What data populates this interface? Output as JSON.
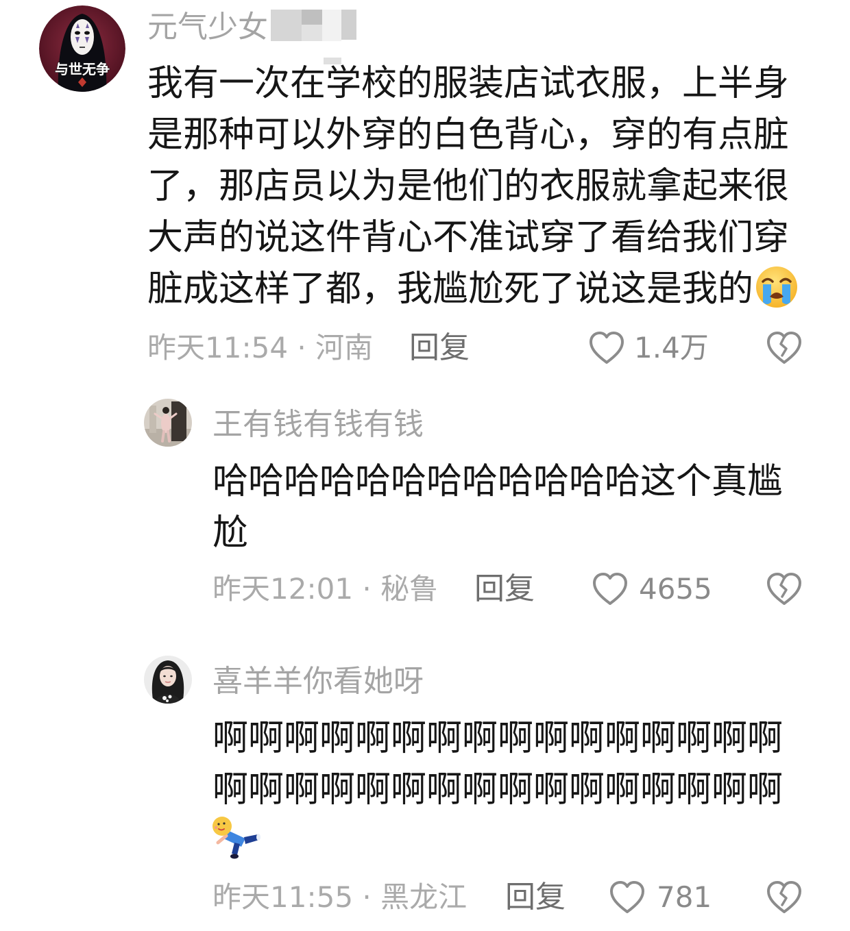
{
  "colors": {
    "background": "#ffffff",
    "comment_text": "#161616",
    "username": "#a4a4a4",
    "meta": "#aaaaaa",
    "reply": "#6e6e6e",
    "icon": "#8c8c8c",
    "avatar_main_bg": "#5c1628"
  },
  "actions": {
    "like_icon": "heart-outline-icon",
    "dislike_icon": "broken-heart-icon"
  },
  "comments": [
    {
      "avatar_icon": "no-face-avatar",
      "avatar_badge_text": "与世无争",
      "username": "元气少女",
      "text_lines": [
        "我有一次在学校的服装店试衣服，上半身",
        "是那种可以外穿的白色背心，穿的有点脏",
        "了，那店员以为是他们的衣服就拿起来很",
        "大声的说这件背心不准试穿了看给我们穿",
        "脏成这样了都，我尴尬死了说这是我的"
      ],
      "trailing_emoji": "loudly-crying-face-emoji",
      "meta": "昨天11:54 · 河南",
      "reply_label": "回复",
      "likes": "1.4万"
    },
    {
      "avatar_icon": "user-photo-avatar",
      "username": "王有钱有钱有钱",
      "text_lines": [
        "哈哈哈哈哈哈哈哈哈哈哈哈这个真尴",
        "尬"
      ],
      "meta": "昨天12:01 · 秘鲁",
      "reply_label": "回复",
      "likes": "4655"
    },
    {
      "avatar_icon": "user-photo-avatar",
      "username": "喜羊羊你看她呀",
      "text_lines": [
        "啊啊啊啊啊啊啊啊啊啊啊啊啊啊啊啊",
        "啊啊啊啊啊啊啊啊啊啊啊啊啊啊啊啊"
      ],
      "trailing_emoji": "falling-figure-sticker",
      "meta": "昨天11:55 · 黑龙江",
      "reply_label": "回复",
      "likes": "781"
    }
  ]
}
